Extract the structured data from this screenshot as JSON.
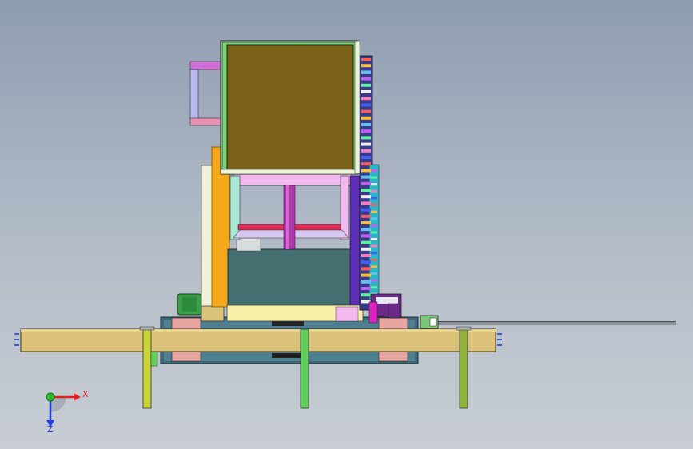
{
  "colors": {
    "background_top": "#8f9db1",
    "background_bottom": "#c8cdd3",
    "base_beam": "#ddc27a",
    "upper_panel": "#7a6118",
    "panel_frame": "#78d276",
    "cabinet": "#456e70",
    "chain_stack": "#5c2fb5",
    "leg_yellow": "#c8d43a",
    "leg_green": "#5fd05a",
    "leg_olive": "#8fb23a",
    "axis_x": "#e02020",
    "axis_y": "#2fbf2f",
    "axis_z": "#2040e0"
  },
  "triad": {
    "x_label": "X",
    "z_label": "Z"
  }
}
